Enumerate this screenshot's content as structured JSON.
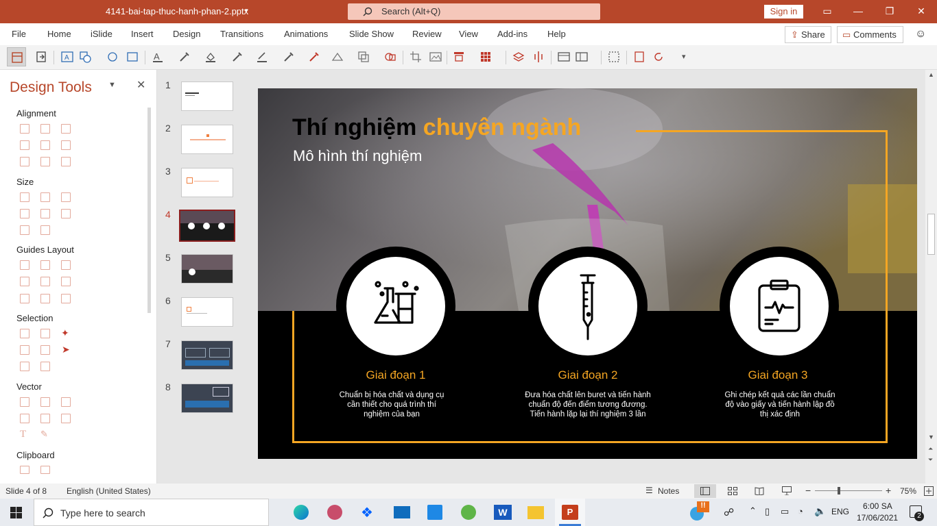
{
  "titlebar": {
    "filename": "4141-bai-tap-thuc-hanh-phan-2.pptx",
    "search_placeholder": "Search (Alt+Q)",
    "sign_in": "Sign in"
  },
  "menu": {
    "items": [
      "File",
      "Home",
      "iSlide",
      "Insert",
      "Design",
      "Transitions",
      "Animations",
      "Slide Show",
      "Review",
      "View",
      "Add-ins",
      "Help"
    ],
    "share": "Share",
    "comments": "Comments"
  },
  "pane": {
    "title": "Design Tools",
    "sections": [
      "Alignment",
      "Size",
      "Guides Layout",
      "Selection",
      "Vector",
      "Clipboard"
    ]
  },
  "thumbnails": {
    "numbers": [
      "1",
      "2",
      "3",
      "4",
      "5",
      "6",
      "7",
      "8"
    ],
    "selected_index": 4
  },
  "slide": {
    "title_part1": "Thí nghiệm ",
    "title_part2": "chuyên ngành",
    "subtitle": "Mô hình thí nghiệm",
    "stages": [
      {
        "title": "Giai đoạn 1",
        "text": "Chuẩn bị hóa chất và dụng cụ cần thiết cho quá trình thí nghiệm của bạn",
        "icon": "lab-flasks-icon"
      },
      {
        "title": "Giai đoạn 2",
        "text": "Đưa hóa chất lên buret và tiến hành chuẩn độ đến điểm tương đương. Tiến hành lặp lại thí nghiệm 3 lần",
        "icon": "syringe-icon"
      },
      {
        "title": "Giai đoạn 3",
        "text": "Ghi chép kết quả các lần chuẩn độ vào giấy và tiến hành lập đồ thị xác định",
        "icon": "clipboard-chart-icon"
      }
    ],
    "colors": {
      "accent": "#f5a623",
      "dark": "#000000",
      "brand": "#b7472a"
    }
  },
  "status": {
    "slide_counter": "Slide 4 of 8",
    "language": "English (United States)",
    "notes": "Notes",
    "zoom": "75%"
  },
  "taskbar": {
    "search_placeholder": "Type here to search",
    "lang": "ENG",
    "time": "6:00 SA",
    "date": "17/06/2021",
    "notif_count": "2"
  }
}
